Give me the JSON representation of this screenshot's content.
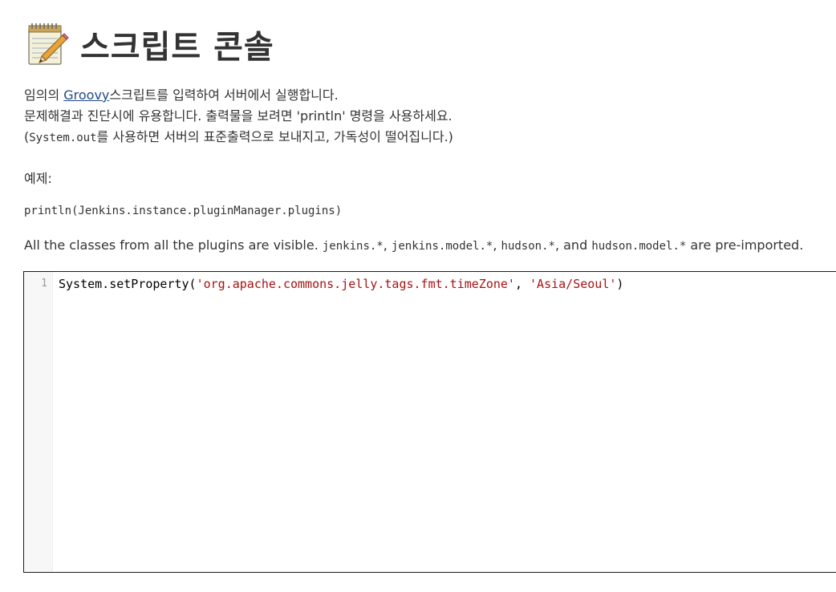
{
  "header": {
    "icon": "notepad-icon",
    "title": "스크립트 콘솔"
  },
  "description": {
    "line1_prefix": "임의의 ",
    "line1_link": "Groovy",
    "line1_suffix": "스크립트를 입력하여 서버에서 실행합니다.",
    "line2": "문제해결과 진단시에 유용합니다. 출력물을 보려면 'println' 명령을 사용하세요.",
    "line3_prefix": "(",
    "line3_code": "System.out",
    "line3_suffix": "를 사용하면 서버의 표준출력으로 보내지고, 가독성이 떨어집니다.)"
  },
  "example": {
    "label": "예제:",
    "code": "println(Jenkins.instance.pluginManager.plugins)"
  },
  "classes_note": {
    "prefix": "All the classes from all the plugins are visible. ",
    "code1": "jenkins.*",
    "sep1": ", ",
    "code2": "jenkins.model.*",
    "sep2": ", ",
    "code3": "hudson.*",
    "sep3": ", and ",
    "code4": "hudson.model.*",
    "suffix": " are pre-imported."
  },
  "editor": {
    "line_number": "1",
    "code_plain1": "System.setProperty(",
    "code_str1": "'org.apache.commons.jelly.tags.fmt.timeZone'",
    "code_plain2": ", ",
    "code_str2": "'Asia/Seoul'",
    "code_plain3": ")"
  },
  "colors": {
    "link": "#204a87",
    "string": "#aa1111",
    "text": "#333333"
  }
}
